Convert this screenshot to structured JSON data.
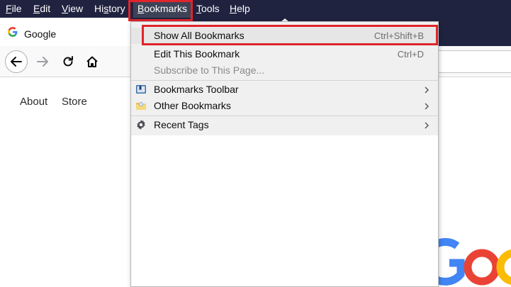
{
  "menubar": {
    "items": [
      {
        "label": "File",
        "acc": "F",
        "rest": "ile"
      },
      {
        "label": "Edit",
        "acc": "E",
        "rest": "dit"
      },
      {
        "label": "View",
        "acc": "V",
        "rest": "iew"
      },
      {
        "label": "History",
        "pre": "Hi",
        "acc": "s",
        "rest": "tory"
      },
      {
        "label": "Bookmarks",
        "acc": "B",
        "rest": "ookmarks"
      },
      {
        "label": "Tools",
        "acc": "T",
        "rest": "ools"
      },
      {
        "label": "Help",
        "acc": "H",
        "rest": "elp"
      }
    ]
  },
  "tab": {
    "title": "Google"
  },
  "page": {
    "about": "About",
    "store": "Store"
  },
  "dropdown": {
    "show_all": {
      "label": "Show All Bookmarks",
      "shortcut": "Ctrl+Shift+B"
    },
    "edit_this": {
      "label": "Edit This Bookmark",
      "shortcut": "Ctrl+D"
    },
    "subscribe": {
      "label": "Subscribe to This Page..."
    },
    "toolbar": {
      "label": "Bookmarks Toolbar"
    },
    "other": {
      "label": "Other Bookmarks"
    },
    "recent": {
      "label": "Recent Tags"
    }
  },
  "colors": {
    "menubar_bg": "#202340",
    "highlight": "#e0242b",
    "menu_bg": "#f0f0f0",
    "google_blue": "#4285f4",
    "google_red": "#ea4335",
    "google_yellow": "#fbbc05",
    "google_green": "#34a853"
  }
}
